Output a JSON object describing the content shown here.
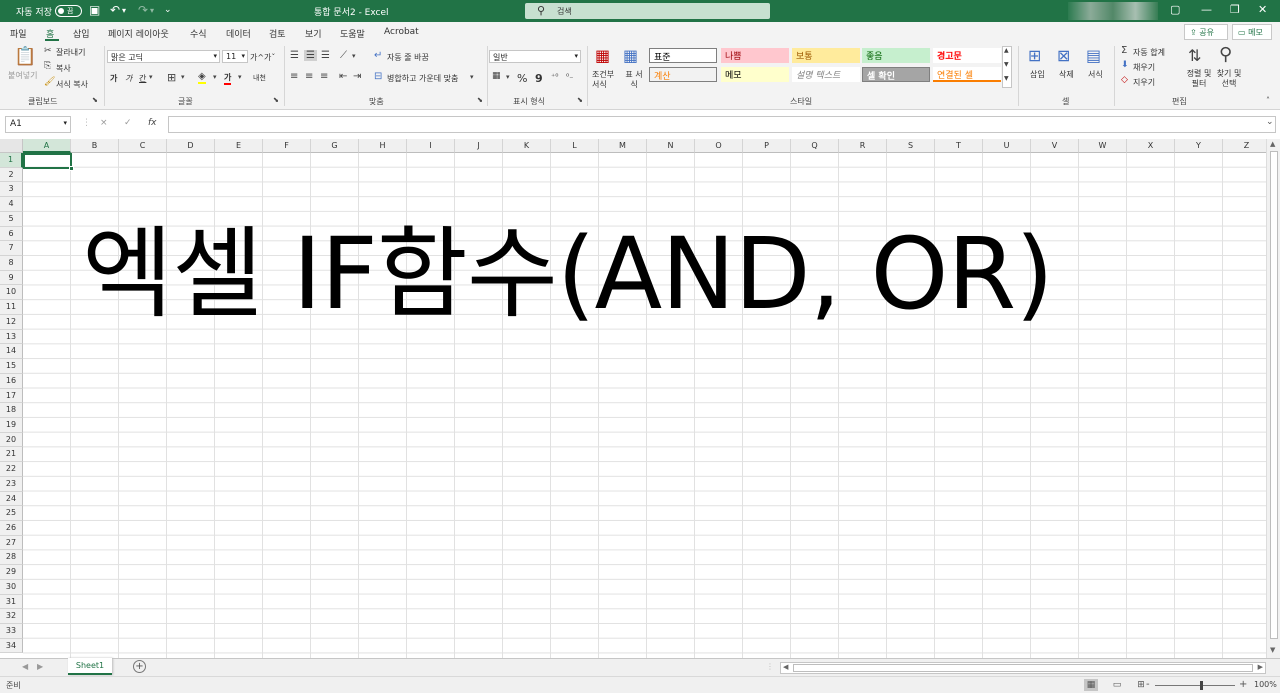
{
  "titlebar": {
    "autosave_label": "자동 저장",
    "autosave_toggle": "끔",
    "doc_title": "통합 문서2  -  Excel",
    "search_placeholder": "검색"
  },
  "menu": {
    "tabs": [
      "파일",
      "홈",
      "삽입",
      "페이지 레이아웃",
      "수식",
      "데이터",
      "검토",
      "보기",
      "도움말",
      "Acrobat"
    ],
    "share": "공유",
    "memo": "메모"
  },
  "ribbon": {
    "clipboard": {
      "paste": "붙여넣기",
      "cut": "잘라내기",
      "copy": "복사",
      "format_painter": "서식 복사",
      "group": "클립보드"
    },
    "font": {
      "name": "맑은 고딕",
      "size": "11",
      "grow": "가^",
      "shrink": "가ˇ",
      "bold": "가",
      "italic": "가",
      "underline": "간",
      "color_a": "가",
      "phonetic": "내천",
      "group": "글꼴"
    },
    "align": {
      "wrap": "자동 줄 바꿈",
      "merge": "병합하고 가운데 맞춤",
      "group": "맞춤"
    },
    "number": {
      "format": "일반",
      "percent": "%",
      "comma": "9",
      "group": "표시 형식"
    },
    "styles": {
      "conditional": "조건부 서식",
      "table": "표 서식",
      "cells": [
        {
          "label": "표준",
          "bg": "#ffffff",
          "fg": "#000000"
        },
        {
          "label": "나쁨",
          "bg": "#ffc7ce",
          "fg": "#9c0006"
        },
        {
          "label": "보통",
          "bg": "#ffeb9c",
          "fg": "#9c5700"
        },
        {
          "label": "좋음",
          "bg": "#c6efce",
          "fg": "#006100"
        },
        {
          "label": "경고문",
          "bg": "#ffffff",
          "fg": "#ff0000"
        },
        {
          "label": "계산",
          "bg": "#f2f2f2",
          "fg": "#fa7d00"
        },
        {
          "label": "메모",
          "bg": "#ffffcc",
          "fg": "#000000"
        },
        {
          "label": "설명 텍스트",
          "bg": "#ffffff",
          "fg": "#7f7f7f"
        },
        {
          "label": "셀 확인",
          "bg": "#a5a5a5",
          "fg": "#ffffff"
        },
        {
          "label": "연결된 셀",
          "bg": "#ffffff",
          "fg": "#fa7d00"
        }
      ],
      "group": "스타일"
    },
    "cells": {
      "insert": "삽입",
      "delete": "삭제",
      "format": "서식",
      "group": "셀"
    },
    "editing": {
      "autosum": "자동 합계",
      "fill": "채우기",
      "clear": "지우기",
      "sort": "정렬 및 필터",
      "find": "찾기 및 선택",
      "group": "편집"
    }
  },
  "formula_bar": {
    "name_box": "A1",
    "cancel": "×",
    "enter": "✓",
    "fx": "fx",
    "value": ""
  },
  "grid": {
    "columns": [
      "A",
      "B",
      "C",
      "D",
      "E",
      "F",
      "G",
      "H",
      "I",
      "J",
      "K",
      "L",
      "M",
      "N",
      "O",
      "P",
      "Q",
      "R",
      "S",
      "T",
      "U",
      "V",
      "W",
      "X",
      "Y",
      "Z"
    ],
    "rows": [
      "1",
      "2",
      "3",
      "4",
      "5",
      "6",
      "7",
      "8",
      "9",
      "10",
      "11",
      "12",
      "13",
      "14",
      "15",
      "16",
      "17",
      "18",
      "19",
      "20",
      "21",
      "22",
      "23",
      "24",
      "25",
      "26",
      "27",
      "28",
      "29",
      "30",
      "31",
      "32",
      "33",
      "34"
    ],
    "selected_cell": "A1",
    "overlay_text": "엑셀 IF함수(AND, OR)"
  },
  "sheets": {
    "tabs": [
      "Sheet1"
    ],
    "add": "+"
  },
  "status": {
    "ready": "준비",
    "zoom": "100%",
    "minus": "-",
    "plus": "+"
  },
  "colors": {
    "accent": "#217346"
  }
}
